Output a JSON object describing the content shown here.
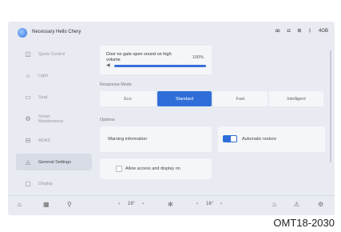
{
  "header": {
    "title": "Necessary Hello Chery",
    "status_icons": [
      "user-icon",
      "screen-icon",
      "signal-icon",
      "bluetooth-icon"
    ],
    "status_text": "4GB"
  },
  "sidebar": {
    "items": [
      {
        "icon": "◫",
        "label": "Quick Control",
        "name": "quick-control"
      },
      {
        "icon": "☼",
        "label": "Light",
        "name": "light"
      },
      {
        "icon": "▭",
        "label": "Seat",
        "name": "seat"
      },
      {
        "icon": "⚙",
        "label": "Smart\nMaintenance",
        "name": "smart-maintenance"
      },
      {
        "icon": "⊟",
        "label": "ADAS",
        "name": "adas"
      },
      {
        "icon": "◬",
        "label": "General Settings",
        "name": "general-settings"
      },
      {
        "icon": "▢",
        "label": "Display",
        "name": "display"
      }
    ]
  },
  "lights_voice": {
    "text": "Door no gate open sound on high volume",
    "duration": "100%",
    "volume_level": 1.0
  },
  "response_mode": {
    "label": "Response Mode",
    "options": [
      "Eco",
      "Standard",
      "Fast",
      "Intelligent"
    ],
    "selected_index": 1
  },
  "options_label": "Options",
  "card_left_text": "Warning information",
  "card_right_text": "Automatic restore",
  "bottom_check_text": "Allow access and display on",
  "bottombar": {
    "left_temp": "16°",
    "right_temp": "16°"
  },
  "caption": "OMT18-2030"
}
